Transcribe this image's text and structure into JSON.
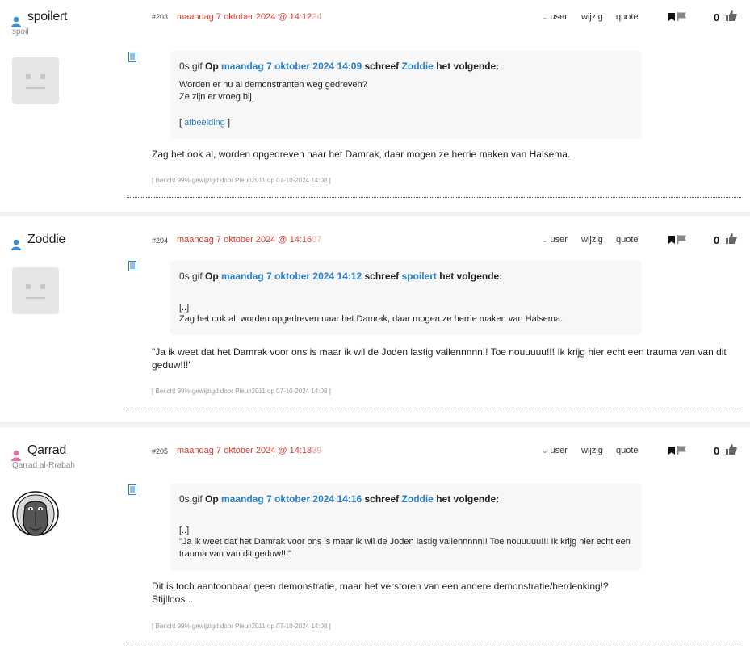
{
  "posts": [
    {
      "username": "spoilert",
      "subtitle": "spoil",
      "number": "#203",
      "date": "maandag 7 oktober 2024 @ 14:12",
      "seconds": "24",
      "actions": {
        "user": "user",
        "edit": "wijzig",
        "quote": "quote"
      },
      "score": "0",
      "quote": {
        "img": "0s.gif",
        "op": "Op",
        "date": "maandag 7 oktober 2024 14:09",
        "schreef": "schreef",
        "author": "Zoddie",
        "volgende": "het volgende:",
        "lines": [
          "Worden er nu al demonstranten weg gedreven?",
          "Ze zijn er vroeg bij."
        ],
        "link_open": "[",
        "link_text": "afbeelding",
        "link_close": "]"
      },
      "text": [
        "Zag het ook al, worden opgedreven naar het Damrak, daar mogen ze herrie maken van Halsema."
      ],
      "edited": "[ Bericht 99% gewijzigd door Pleun2011 op 07-10-2024 14:08 ]"
    },
    {
      "username": "Zoddie",
      "subtitle": "",
      "number": "#204",
      "date": "maandag 7 oktober 2024 @ 14:16",
      "seconds": "07",
      "actions": {
        "user": "user",
        "edit": "wijzig",
        "quote": "quote"
      },
      "score": "0",
      "quote": {
        "img": "0s.gif",
        "op": "Op",
        "date": "maandag 7 oktober 2024 14:12",
        "schreef": "schreef",
        "author": "spoilert",
        "volgende": "het volgende:",
        "lines": [
          "[..]",
          "Zag het ook al, worden opgedreven naar het Damrak, daar mogen ze herrie maken van Halsema."
        ]
      },
      "text": [
        "\"Ja ik weet dat het Damrak voor ons is maar ik wil de Joden lastig vallennnnn!! Toe nouuuuu!!! Ik krijg hier echt een trauma van van dit",
        "geduw!!!\""
      ],
      "edited": "[ Bericht 99% gewijzigd door Pleun2011 op 07-10-2024 14:08 ]"
    },
    {
      "username": "Qarrad",
      "subtitle": "Qarrad al-Rrabah",
      "number": "#205",
      "date": "maandag 7 oktober 2024 @ 14:18",
      "seconds": "39",
      "actions": {
        "user": "user",
        "edit": "wijzig",
        "quote": "quote"
      },
      "score": "0",
      "quote": {
        "img": "0s.gif",
        "op": "Op",
        "date": "maandag 7 oktober 2024 14:16",
        "schreef": "schreef",
        "author": "Zoddie",
        "volgende": "het volgende:",
        "lines": [
          "[..]",
          "\"Ja ik weet dat het Damrak voor ons is maar ik wil de Joden lastig vallennnnn!! Toe nouuuuu!!! Ik krijg hier echt een",
          "trauma van van dit geduw!!!\""
        ]
      },
      "text": [
        "Dit is toch aantoonbaar geen demonstratie, maar het verstoren van een andere demonstratie/herdenking!?",
        "Stijlloos..."
      ],
      "edited": "[ Bericht 99% gewijzigd door Pleun2011 op 07-10-2024 14:08 ]"
    }
  ],
  "colors": {
    "date": "#d43a2f",
    "link": "#2a7fc9",
    "male_icon": "#3b8fd9",
    "female_icon": "#e86aa6"
  },
  "icons": [
    "user-icon",
    "bookmark-icon",
    "flag-icon",
    "thumbs-up-icon",
    "document-icon",
    "chevron-down-icon"
  ]
}
